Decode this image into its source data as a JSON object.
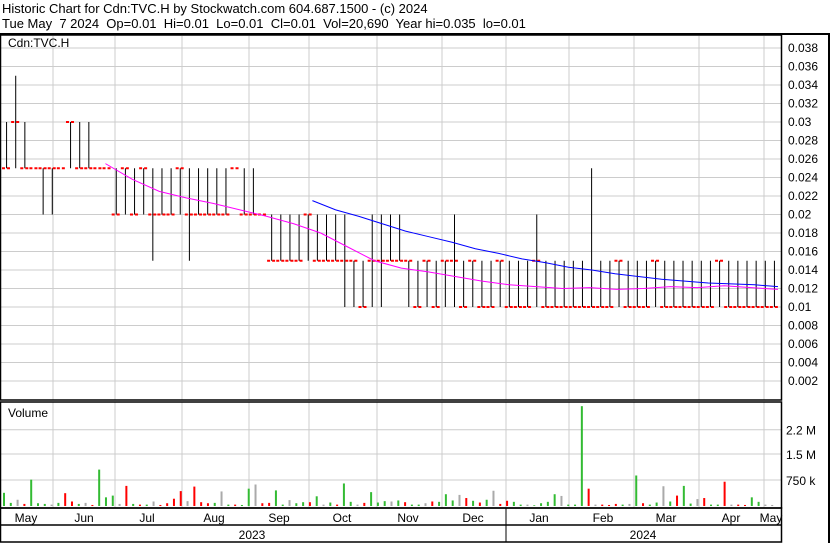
{
  "header": {
    "title": "Historic Chart for Cdn:TVC.H by Stockwatch.com 604.687.1500 - (c) 2024",
    "quote": "Tue May  7 2024  Op=0.01  Hi=0.01  Lo=0.01  Cl=0.01  Vol=20,690  Year hi=0.035  lo=0.01"
  },
  "chart_data": [
    {
      "type": "bar",
      "title": "Cdn:TVC.H",
      "ylim": [
        0,
        0.04
      ],
      "yticks": [
        "0.038",
        "0.036",
        "0.034",
        "0.032",
        "0.03",
        "0.028",
        "0.026",
        "0.024",
        "0.022",
        "0.02",
        "0.018",
        "0.016",
        "0.014",
        "0.012",
        "0.01",
        "0.008",
        "0.006",
        "0.004",
        "0.002"
      ],
      "ytick_values": [
        0.038,
        0.036,
        0.034,
        0.032,
        0.03,
        0.028,
        0.026,
        0.024,
        0.022,
        0.02,
        0.018,
        0.016,
        0.014,
        0.012,
        0.01,
        0.008,
        0.006,
        0.004,
        0.002
      ],
      "bars_hi_lo_close": [
        [
          0.03,
          0.025,
          0.025
        ],
        [
          0.035,
          0.025,
          0.03
        ],
        [
          0.03,
          0.025,
          0.025
        ],
        [
          0.025,
          0.025,
          0.025
        ],
        [
          0.025,
          0.02,
          0.025
        ],
        [
          0.025,
          0.02,
          0.025
        ],
        [
          0.025,
          0.025,
          0.025
        ],
        [
          0.03,
          0.025,
          0.03
        ],
        [
          0.03,
          0.025,
          0.025
        ],
        [
          0.03,
          0.025,
          0.025
        ],
        [
          0.025,
          0.025,
          0.025
        ],
        [
          0.025,
          0.025,
          0.025
        ],
        [
          0.025,
          0.02,
          0.02
        ],
        [
          0.025,
          0.02,
          0.025
        ],
        [
          0.025,
          0.02,
          0.02
        ],
        [
          0.025,
          0.02,
          0.025
        ],
        [
          0.025,
          0.015,
          0.02
        ],
        [
          0.025,
          0.02,
          0.02
        ],
        [
          0.025,
          0.02,
          0.02
        ],
        [
          0.025,
          0.02,
          0.025
        ],
        [
          0.025,
          0.015,
          0.02
        ],
        [
          0.025,
          0.02,
          0.02
        ],
        [
          0.025,
          0.02,
          0.02
        ],
        [
          0.025,
          0.02,
          0.02
        ],
        [
          0.025,
          0.02,
          0.02
        ],
        [
          0.025,
          0.025,
          0.025
        ],
        [
          0.025,
          0.02,
          0.02
        ],
        [
          0.025,
          0.02,
          0.02
        ],
        [
          0.02,
          0.02,
          0.02
        ],
        [
          0.02,
          0.015,
          0.015
        ],
        [
          0.02,
          0.015,
          0.015
        ],
        [
          0.02,
          0.015,
          0.015
        ],
        [
          0.02,
          0.015,
          0.015
        ],
        [
          0.02,
          0.015,
          0.02
        ],
        [
          0.02,
          0.015,
          0.015
        ],
        [
          0.02,
          0.015,
          0.015
        ],
        [
          0.02,
          0.015,
          0.015
        ],
        [
          0.02,
          0.01,
          0.015
        ],
        [
          0.015,
          0.01,
          0.015
        ],
        [
          0.015,
          0.01,
          0.01
        ],
        [
          0.02,
          0.01,
          0.015
        ],
        [
          0.02,
          0.01,
          0.015
        ],
        [
          0.02,
          0.015,
          0.015
        ],
        [
          0.02,
          0.015,
          0.015
        ],
        [
          0.015,
          0.01,
          0.015
        ],
        [
          0.015,
          0.01,
          0.01
        ],
        [
          0.015,
          0.01,
          0.015
        ],
        [
          0.015,
          0.01,
          0.01
        ],
        [
          0.015,
          0.01,
          0.015
        ],
        [
          0.02,
          0.01,
          0.015
        ],
        [
          0.015,
          0.01,
          0.01
        ],
        [
          0.015,
          0.01,
          0.015
        ],
        [
          0.015,
          0.01,
          0.01
        ],
        [
          0.015,
          0.01,
          0.01
        ],
        [
          0.015,
          0.01,
          0.015
        ],
        [
          0.015,
          0.01,
          0.01
        ],
        [
          0.015,
          0.01,
          0.01
        ],
        [
          0.015,
          0.01,
          0.01
        ],
        [
          0.02,
          0.01,
          0.015
        ],
        [
          0.015,
          0.01,
          0.01
        ],
        [
          0.015,
          0.01,
          0.01
        ],
        [
          0.015,
          0.01,
          0.01
        ],
        [
          0.015,
          0.01,
          0.01
        ],
        [
          0.015,
          0.01,
          0.01
        ],
        [
          0.025,
          0.01,
          0.01
        ],
        [
          0.015,
          0.01,
          0.01
        ],
        [
          0.015,
          0.01,
          0.01
        ],
        [
          0.015,
          0.01,
          0.015
        ],
        [
          0.015,
          0.01,
          0.01
        ],
        [
          0.015,
          0.01,
          0.01
        ],
        [
          0.015,
          0.01,
          0.01
        ],
        [
          0.015,
          0.01,
          0.015
        ],
        [
          0.015,
          0.01,
          0.01
        ],
        [
          0.015,
          0.01,
          0.01
        ],
        [
          0.015,
          0.01,
          0.01
        ],
        [
          0.015,
          0.01,
          0.01
        ],
        [
          0.015,
          0.01,
          0.01
        ],
        [
          0.015,
          0.01,
          0.01
        ],
        [
          0.015,
          0.01,
          0.015
        ],
        [
          0.015,
          0.01,
          0.01
        ],
        [
          0.015,
          0.01,
          0.01
        ],
        [
          0.015,
          0.01,
          0.01
        ],
        [
          0.015,
          0.01,
          0.01
        ],
        [
          0.015,
          0.01,
          0.01
        ],
        [
          0.015,
          0.01,
          0.01
        ]
      ],
      "ma_long": [
        [
          0.0215,
          0.0205,
          0.0198,
          0.019,
          0.0182,
          0.0176,
          0.017,
          0.0163,
          0.0158,
          0.0152,
          0.0148,
          0.0143,
          0.014,
          0.0136,
          0.0133,
          0.013,
          0.0128,
          0.0126,
          0.0125,
          0.0124,
          0.0122
        ],
        0.4
      ],
      "ma_short": [
        [
          0.0255,
          0.0238,
          0.0225,
          0.0218,
          0.0212,
          0.0205,
          0.0198,
          0.019,
          0.018,
          0.0165,
          0.015,
          0.0142,
          0.0138,
          0.0133,
          0.0128,
          0.0124,
          0.0122,
          0.012,
          0.0121,
          0.0119,
          0.012,
          0.0122,
          0.0121,
          0.0123,
          0.0121,
          0.0119
        ],
        0.135
      ],
      "colors": {
        "bar": "#000000",
        "close": "#ff0000",
        "ma_long": "#0000ff",
        "ma_short": "#ff00ff"
      }
    },
    {
      "type": "bar",
      "title": "Volume",
      "yticks": [
        "2.2 M",
        "1.5 M",
        "750 k"
      ],
      "ytick_values": [
        2200000,
        1500000,
        750000
      ],
      "values": [
        380000,
        90000,
        180000,
        60000,
        760000,
        80000,
        60000,
        40000,
        90000,
        370000,
        130000,
        60000,
        90000,
        30000,
        1050000,
        250000,
        300000,
        60000,
        580000,
        60000,
        40000,
        40000,
        130000,
        30000,
        80000,
        210000,
        430000,
        140000,
        560000,
        110000,
        80000,
        90000,
        420000,
        40000,
        40000,
        30000,
        500000,
        620000,
        80000,
        90000,
        450000,
        40000,
        170000,
        80000,
        110000,
        110000,
        280000,
        40000,
        100000,
        40000,
        650000,
        120000,
        40000,
        90000,
        400000,
        100000,
        140000,
        130000,
        160000,
        110000,
        40000,
        40000,
        80000,
        130000,
        120000,
        340000,
        160000,
        320000,
        230000,
        150000,
        100000,
        180000,
        440000,
        60000,
        150000,
        120000,
        40000,
        40000,
        20000,
        80000,
        120000,
        340000,
        290000,
        40000,
        40000,
        2880000,
        500000,
        40000,
        40000,
        30000,
        60000,
        40000,
        60000,
        880000,
        80000,
        40000,
        100000,
        570000,
        130000,
        300000,
        580000,
        70000,
        200000,
        230000,
        40000,
        40000,
        700000,
        40000,
        40000,
        30000,
        250000,
        120000,
        40000,
        30000
      ],
      "colors_seq": "gggrgggggrrggrggggrgrgrrrrrgrrrgggrgggrrgggggrgrgrgggrgggggrgggrgggrrgrggrrgggggggggggrgrrrgrgrggrgrgggrggrgrrgg"
    },
    {
      "type": "axis",
      "months": [
        "May",
        "Jun",
        "Jul",
        "Aug",
        "Sep",
        "Oct",
        "Nov",
        "Dec",
        "Jan",
        "Feb",
        "Mar",
        "Apr",
        "May"
      ],
      "years": [
        "2023",
        "2024"
      ]
    }
  ]
}
